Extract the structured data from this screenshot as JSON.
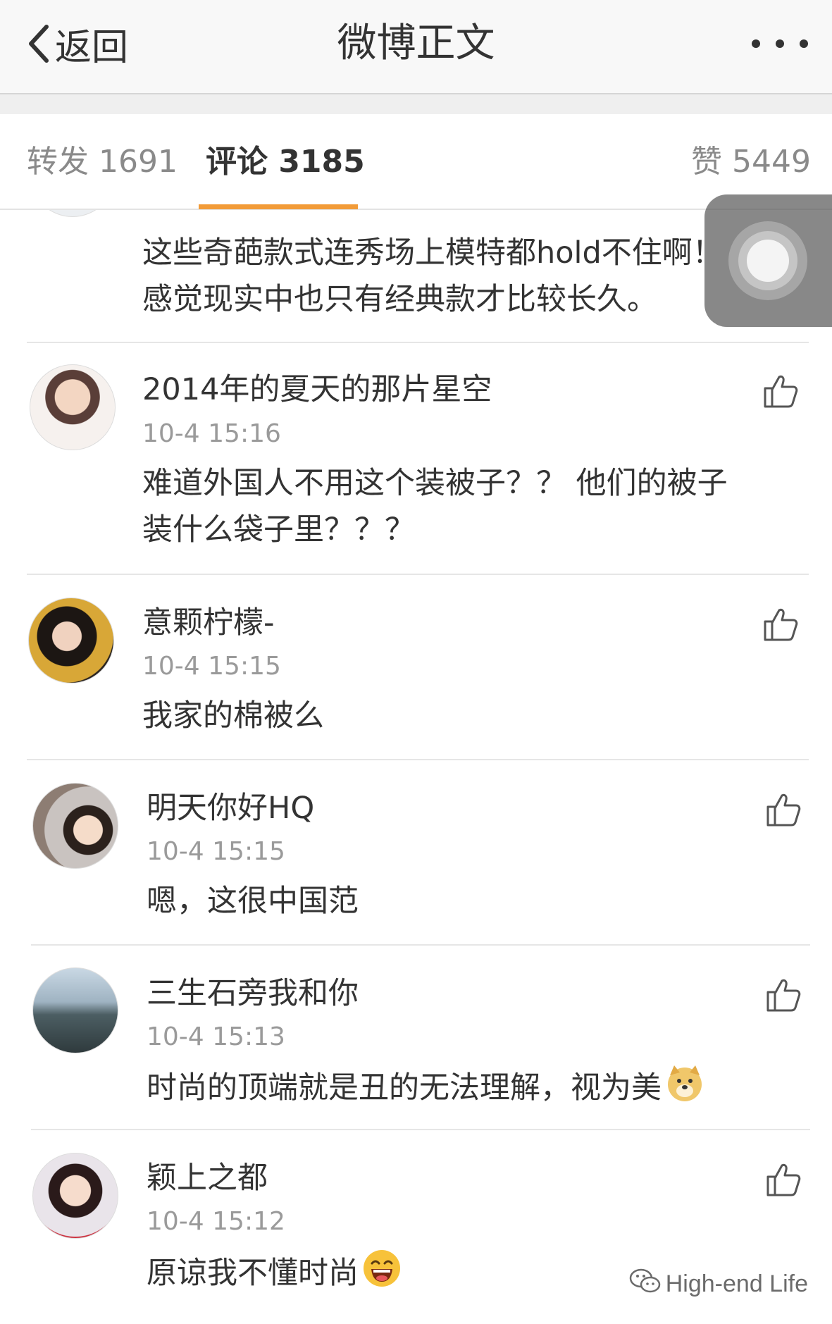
{
  "navbar": {
    "back_label": "返回",
    "title": "微博正文"
  },
  "tabs": {
    "repost": "转发 1691",
    "comment": "评论 3185",
    "like": "赞 5449",
    "accent_color": "#f29b38"
  },
  "partial_comment": {
    "lines": [
      "这些奇葩款式连秀场上模特都hold不住啊！",
      "感觉现实中也只有经典款才比较长久。"
    ]
  },
  "comments": [
    {
      "username": "2014年的夏天的那片星空",
      "time": "10-4 15:16",
      "lines": [
        "难道外国人不用这个装被子？？ 他们的被子",
        "装什么袋子里？？？"
      ]
    },
    {
      "username": "意颗柠檬-",
      "time": "10-4 15:15",
      "lines": [
        "我家的棉被么"
      ]
    },
    {
      "username": "明天你好HQ",
      "time": "10-4 15:15",
      "lines": [
        "嗯，这很中国范"
      ]
    },
    {
      "username": "三生石旁我和你",
      "time": "10-4 15:13",
      "lines": [
        "时尚的顶端就是丑的无法理解，视为美"
      ],
      "emoji": "doge"
    },
    {
      "username": "颖上之都",
      "time": "10-4 15:12",
      "lines": [
        "原谅我不懂时尚"
      ],
      "emoji": "laugh"
    }
  ],
  "watermark": "High-end Life"
}
